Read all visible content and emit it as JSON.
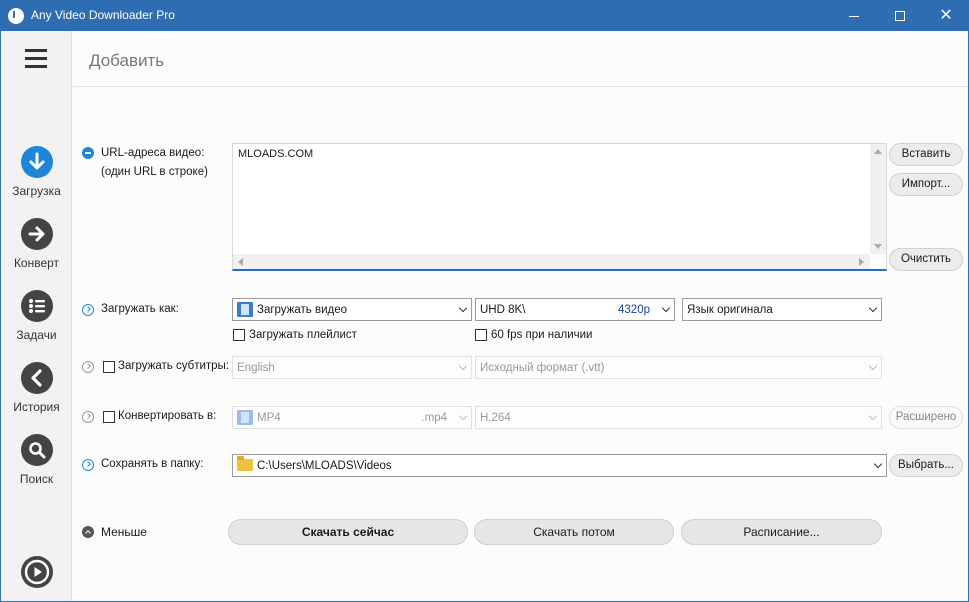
{
  "window": {
    "title": "Any Video Downloader Pro"
  },
  "sidebar": {
    "items": [
      {
        "label": "Загрузка",
        "icon": "download-arrow-icon"
      },
      {
        "label": "Конверт",
        "icon": "arrow-right-icon"
      },
      {
        "label": "Задачи",
        "icon": "list-icon"
      },
      {
        "label": "История",
        "icon": "chevron-left-icon"
      },
      {
        "label": "Поиск",
        "icon": "search-icon"
      }
    ],
    "bottom_icon": "play-icon"
  },
  "header": {
    "title": "Добавить"
  },
  "url_section": {
    "label_line1": "URL-адреса видео:",
    "label_line2": "(один URL в строке)",
    "value": "MLOADS.COM",
    "paste_label": "Вставить",
    "import_label": "Импорт...",
    "clear_label": "Очистить"
  },
  "download_as": {
    "label": "Загружать как:",
    "mode": "Загружать видео",
    "quality": "UHD 8K\\",
    "quality_suffix": "4320p",
    "language": "Язык оригинала",
    "playlist_label": "Загружать плейлист",
    "fps_label": "60 fps при наличии"
  },
  "subtitles": {
    "label": "Загружать субтитры:",
    "language": "English",
    "format": "Исходный формат (.vtt)"
  },
  "convert": {
    "label": "Конвертировать в:",
    "format": "MP4",
    "format_ext": ".mp4",
    "codec": "H.264",
    "advanced_label": "Расширено"
  },
  "save_to": {
    "label": "Сохранять в папку:",
    "path": "C:\\Users\\MLOADS\\Videos",
    "browse_label": "Выбрать..."
  },
  "footer": {
    "less_label": "Меньше",
    "download_now_label": "Скачать сейчас",
    "download_later_label": "Скачать потом",
    "schedule_label": "Расписание..."
  }
}
